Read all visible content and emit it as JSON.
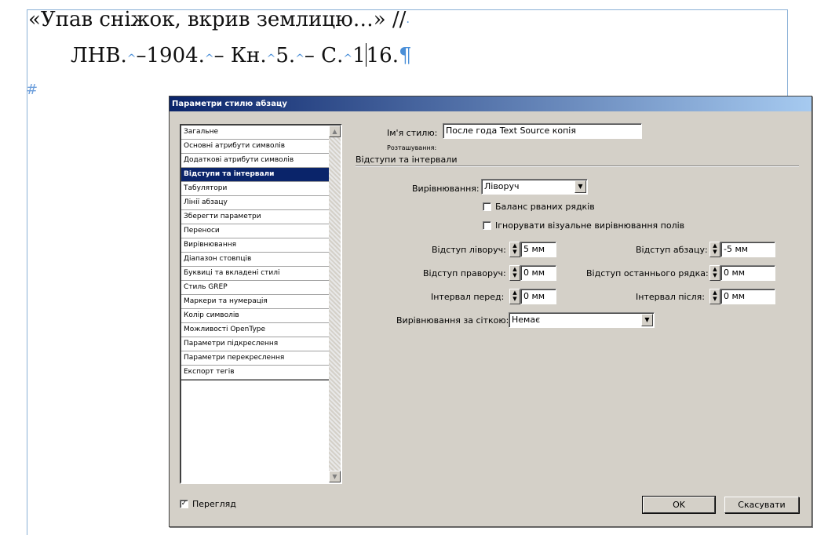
{
  "document": {
    "line1": "«Упав сніжок, вкрив землицю…» //",
    "line2_a": "ЛНВ.",
    "line2_b": "–1904.",
    "line2_c": "– Кн.",
    "line2_d": "5.",
    "line2_e": "– С.",
    "line2_f": "1",
    "line2_g": "16.",
    "pilcrow": "¶",
    "hash": "#"
  },
  "dialog": {
    "title": "Параметри стилю абзацу",
    "sidebar_items": [
      "Загальне",
      "Основні атрибути символів",
      "Додаткові атрибути символів",
      "Відступи та інтервали",
      "Табулятори",
      "Лінії абзацу",
      "Зберегти параметри",
      "Переноси",
      "Вирівнювання",
      "Діапазон стовпців",
      "Буквиці та вкладені стилі",
      "Стиль GREP",
      "Маркери та нумерація",
      "Колір символів",
      "Можливості OpenType",
      "Параметри підкреслення",
      "Параметри перекреслення",
      "Експорт тегів"
    ],
    "selected_item": "Відступи та інтервали",
    "style_name_label": "Ім'я стилю:",
    "style_name_value": "После года Text Source копія",
    "location_label": "Розташування:",
    "section_title": "Відступи та інтервали",
    "alignment_label": "Вирівнювання:",
    "alignment_value": "Ліворуч",
    "balance_label": "Баланс рваних рядків",
    "balance_checked": false,
    "ignore_label": "Ігнорувати візуальне вирівнювання полів",
    "ignore_checked": false,
    "left_indent_label": "Відступ ліворуч:",
    "left_indent_value": "5 мм",
    "right_indent_label": "Відступ праворуч:",
    "right_indent_value": "0 мм",
    "space_before_label": "Інтервал перед:",
    "space_before_value": "0 мм",
    "first_line_label": "Відступ абзацу:",
    "first_line_value": "-5 мм",
    "last_line_label": "Відступ останнього рядка:",
    "last_line_value": "0 мм",
    "space_after_label": "Інтервал після:",
    "space_after_value": "0 мм",
    "grid_label": "Вирівнювання за сіткою:",
    "grid_value": "Немає",
    "preview_label": "Перегляд",
    "preview_checked": true,
    "ok_label": "OK",
    "cancel_label": "Скасувати"
  }
}
